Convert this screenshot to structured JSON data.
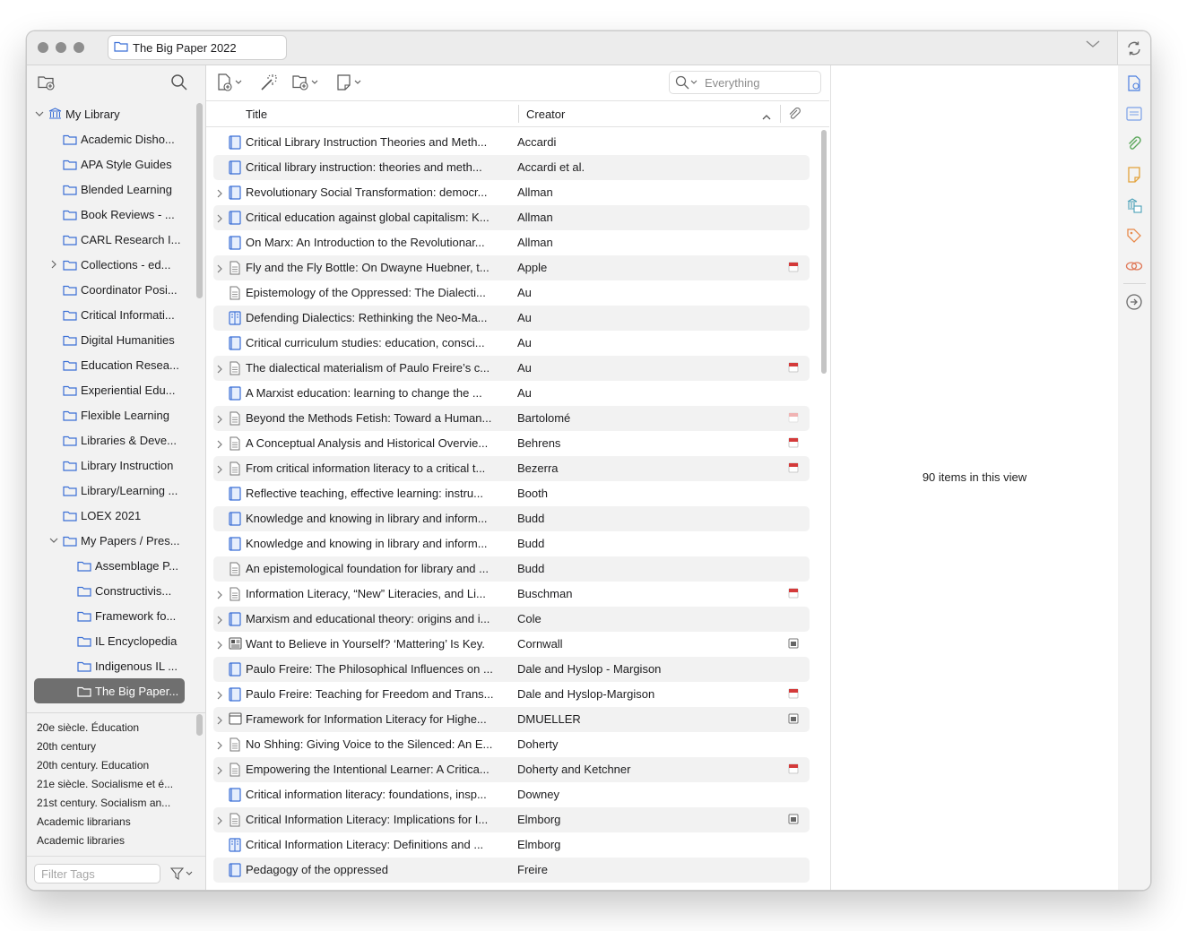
{
  "window": {
    "tab_title": "The Big Paper 2022"
  },
  "collections": [
    {
      "label": "My Library",
      "level": 0,
      "expanded": true,
      "icon": "library-icon"
    },
    {
      "label": "Academic Disho...",
      "level": 1
    },
    {
      "label": "APA Style Guides",
      "level": 1
    },
    {
      "label": "Blended Learning",
      "level": 1
    },
    {
      "label": "Book Reviews - ...",
      "level": 1
    },
    {
      "label": "CARL Research I...",
      "level": 1
    },
    {
      "label": "Collections - ed...",
      "level": 1,
      "collapsed": true
    },
    {
      "label": "Coordinator Posi...",
      "level": 1
    },
    {
      "label": "Critical Informati...",
      "level": 1
    },
    {
      "label": "Digital Humanities",
      "level": 1
    },
    {
      "label": "Education Resea...",
      "level": 1
    },
    {
      "label": "Experiential Edu...",
      "level": 1
    },
    {
      "label": "Flexible Learning",
      "level": 1
    },
    {
      "label": "Libraries & Deve...",
      "level": 1
    },
    {
      "label": "Library Instruction",
      "level": 1
    },
    {
      "label": "Library/Learning ...",
      "level": 1
    },
    {
      "label": "LOEX 2021",
      "level": 1
    },
    {
      "label": "My Papers / Pres...",
      "level": 1,
      "expanded": true
    },
    {
      "label": "Assemblage P...",
      "level": 2
    },
    {
      "label": "Constructivis...",
      "level": 2
    },
    {
      "label": "Framework fo...",
      "level": 2
    },
    {
      "label": "IL Encyclopedia",
      "level": 2
    },
    {
      "label": "Indigenous IL ...",
      "level": 2
    },
    {
      "label": "The Big Paper...",
      "level": 2,
      "selected": true
    }
  ],
  "tags": [
    "20e siècle. Éducation",
    "20th century",
    "20th century. Education",
    "21e siècle. Socialisme et é...",
    "21st century. Socialism an...",
    "Academic librarians",
    "Academic libraries"
  ],
  "tag_filter": {
    "placeholder": "Filter Tags"
  },
  "search": {
    "placeholder": "Everything"
  },
  "columns": {
    "title": "Title",
    "creator": "Creator"
  },
  "items": [
    {
      "title": "Critical Library Instruction Theories and Meth...",
      "creator": "Accardi",
      "type": "book",
      "twisty": false,
      "att": ""
    },
    {
      "title": "Critical library instruction: theories and meth...",
      "creator": "Accardi et al.",
      "type": "book",
      "twisty": false,
      "att": ""
    },
    {
      "title": "Revolutionary Social Transformation: democr...",
      "creator": "Allman",
      "type": "book",
      "twisty": true,
      "att": ""
    },
    {
      "title": "Critical education against global capitalism: K...",
      "creator": "Allman",
      "type": "book",
      "twisty": true,
      "att": ""
    },
    {
      "title": "On Marx: An Introduction to the Revolutionar...",
      "creator": "Allman",
      "type": "book",
      "twisty": false,
      "att": ""
    },
    {
      "title": "Fly and the Fly Bottle: On Dwayne Huebner, t...",
      "creator": "Apple",
      "type": "article",
      "twisty": true,
      "att": "pdf"
    },
    {
      "title": "Epistemology of the Oppressed: The Dialecti...",
      "creator": "Au",
      "type": "article",
      "twisty": false,
      "att": ""
    },
    {
      "title": "Defending Dialectics: Rethinking the Neo-Ma...",
      "creator": "Au",
      "type": "section",
      "twisty": false,
      "att": ""
    },
    {
      "title": "Critical curriculum studies: education, consci...",
      "creator": "Au",
      "type": "book",
      "twisty": false,
      "att": ""
    },
    {
      "title": "The dialectical materialism of Paulo Freire’s c...",
      "creator": "Au",
      "type": "article",
      "twisty": true,
      "att": "pdf"
    },
    {
      "title": "A Marxist education: learning to change the ...",
      "creator": "Au",
      "type": "book",
      "twisty": false,
      "att": ""
    },
    {
      "title": "Beyond the Methods Fetish: Toward a Human...",
      "creator": "Bartolomé",
      "type": "article",
      "twisty": true,
      "att": "pdf-faded"
    },
    {
      "title": "A Conceptual Analysis and Historical Overvie...",
      "creator": "Behrens",
      "type": "article",
      "twisty": true,
      "att": "pdf"
    },
    {
      "title": "From critical information literacy to a critical t...",
      "creator": "Bezerra",
      "type": "article",
      "twisty": true,
      "att": "pdf"
    },
    {
      "title": "Reflective teaching, effective learning: instru...",
      "creator": "Booth",
      "type": "book",
      "twisty": false,
      "att": ""
    },
    {
      "title": "Knowledge and knowing in library and inform...",
      "creator": "Budd",
      "type": "book",
      "twisty": false,
      "att": ""
    },
    {
      "title": "Knowledge and knowing in library and inform...",
      "creator": "Budd",
      "type": "book",
      "twisty": false,
      "att": ""
    },
    {
      "title": "An epistemological foundation for library and ...",
      "creator": "Budd",
      "type": "article",
      "twisty": false,
      "att": ""
    },
    {
      "title": "Information Literacy, “New” Literacies, and Li...",
      "creator": "Buschman",
      "type": "article",
      "twisty": true,
      "att": "pdf"
    },
    {
      "title": "Marxism and educational theory: origins and i...",
      "creator": "Cole",
      "type": "book",
      "twisty": true,
      "att": ""
    },
    {
      "title": "Want to Believe in Yourself? ‘Mattering’ Is Key.",
      "creator": "Cornwall",
      "type": "newspaper",
      "twisty": true,
      "att": "snapshot"
    },
    {
      "title": "Paulo Freire: The Philosophical Influences on ...",
      "creator": "Dale and Hyslop - Margison",
      "type": "book",
      "twisty": false,
      "att": ""
    },
    {
      "title": "Paulo Freire: Teaching for Freedom and Trans...",
      "creator": "Dale and Hyslop-Margison",
      "type": "book",
      "twisty": true,
      "att": "pdf"
    },
    {
      "title": "Framework for Information Literacy for Highe...",
      "creator": "DMUELLER",
      "type": "webpage",
      "twisty": true,
      "att": "snapshot"
    },
    {
      "title": "No Shhing: Giving Voice to the Silenced: An E...",
      "creator": "Doherty",
      "type": "article",
      "twisty": true,
      "att": ""
    },
    {
      "title": "Empowering the Intentional Learner: A Critica...",
      "creator": "Doherty and Ketchner",
      "type": "article",
      "twisty": true,
      "att": "pdf"
    },
    {
      "title": "Critical information literacy: foundations, insp...",
      "creator": "Downey",
      "type": "book",
      "twisty": false,
      "att": ""
    },
    {
      "title": "Critical Information Literacy: Implications for I...",
      "creator": "Elmborg",
      "type": "article",
      "twisty": true,
      "att": "snapshot"
    },
    {
      "title": "Critical Information Literacy: Definitions and ...",
      "creator": "Elmborg",
      "type": "section",
      "twisty": false,
      "att": ""
    },
    {
      "title": "Pedagogy of the oppressed",
      "creator": "Freire",
      "type": "book",
      "twisty": false,
      "att": ""
    }
  ],
  "info": {
    "count_text": "90 items in this view"
  },
  "colors": {
    "accent_blue": "#3b6fd6",
    "pdf_red": "#d43a3a",
    "selected_bg": "#6f6f6f"
  }
}
